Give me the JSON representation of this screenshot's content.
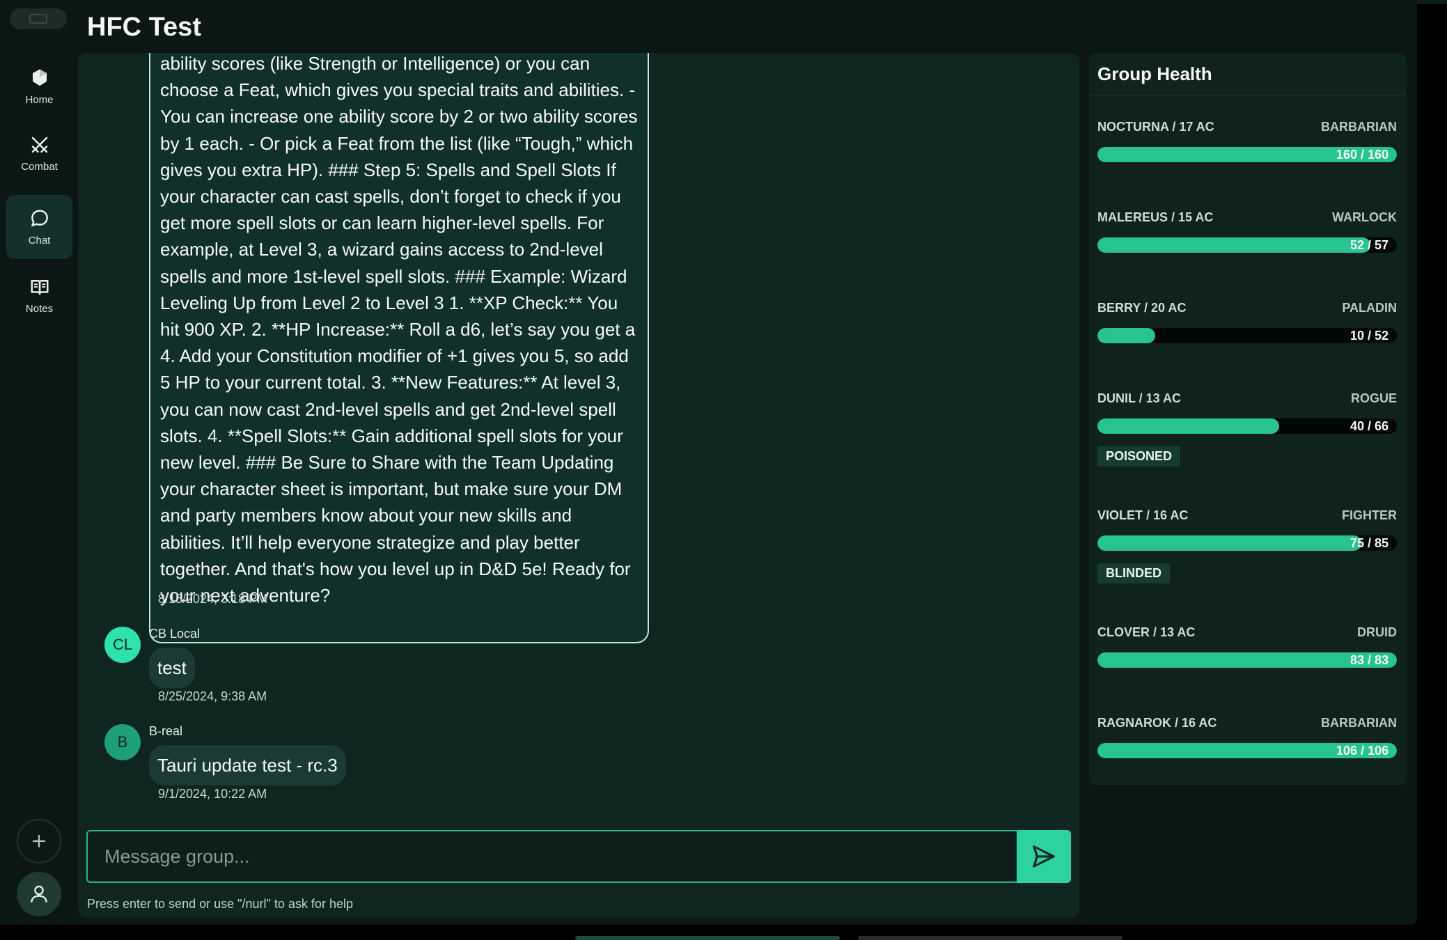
{
  "app": {
    "title": "HFC Test"
  },
  "sidebar": {
    "items": [
      {
        "label": "Home",
        "icon": "home-icon"
      },
      {
        "label": "Combat",
        "icon": "combat-icon"
      },
      {
        "label": "Chat",
        "icon": "chat-icon",
        "active": true
      },
      {
        "label": "Notes",
        "icon": "notes-icon"
      }
    ],
    "add_icon": "plus-icon",
    "user_icon": "user-icon"
  },
  "chat": {
    "long_message": {
      "text": "ability scores (like Strength or Intelligence) or you can choose a Feat, which gives you special traits and abilities. - You can increase one ability score by 2 or two ability scores by 1 each. - Or pick a Feat from the list (like “Tough,” which gives you extra HP). ### Step 5: Spells and Spell Slots If your character can cast spells, don’t forget to check if you get more spell slots or can learn higher-level spells. For example, at Level 3, a wizard gains access to 2nd-level spells and more 1st-level spell slots. ### Example: Wizard Leveling Up from Level 2 to Level 3 1. **XP Check:** You hit 900 XP. 2. **HP Increase:** Roll a d6, let’s say you get a 4. Add your Constitution modifier of +1 gives you 5, so add 5 HP to your current total. 3. **New Features:** At level 3, you can now cast 2nd-level spells and get 2nd-level spell slots. 4. **Spell Slots:** Gain additional spell slots for your new level. ### Be Sure to Share with the Team Updating your character sheet is important, but make sure your DM and party members know about your new skills and abilities. It’ll help everyone strategize and play better together. And that's how you level up in D&D 5e! Ready for your next adventure?",
      "timestamp": "8/15/2024, 3:18 PM"
    },
    "messages": [
      {
        "initials": "CL",
        "author": "CB Local",
        "text": "test",
        "timestamp": "8/25/2024, 9:38 AM"
      },
      {
        "initials": "B",
        "author": "B-real",
        "text": "Tauri update test - rc.3",
        "timestamp": "9/1/2024, 10:22 AM"
      }
    ],
    "composer": {
      "placeholder": "Message group...",
      "send_icon": "send-icon",
      "hint": "Press enter to send or use \"/nurl\" to ask for help"
    }
  },
  "group_health": {
    "title": "Group Health",
    "members": [
      {
        "name": "NOCTURNA / 17 AC",
        "class": "BARBARIAN",
        "hp": "160 / 160",
        "fraction": 1.0,
        "conditions": []
      },
      {
        "name": "MALEREUS / 15 AC",
        "class": "WARLOCK",
        "hp": "52 / 57",
        "fraction": 0.912,
        "conditions": []
      },
      {
        "name": "BERRY / 20 AC",
        "class": "PALADIN",
        "hp": "10 / 52",
        "fraction": 0.192,
        "conditions": []
      },
      {
        "name": "DUNIL / 13 AC",
        "class": "ROGUE",
        "hp": "40 / 66",
        "fraction": 0.606,
        "conditions": [
          "POISONED"
        ]
      },
      {
        "name": "VIOLET / 16 AC",
        "class": "FIGHTER",
        "hp": "75 / 85",
        "fraction": 0.882,
        "conditions": [
          "BLINDED"
        ]
      },
      {
        "name": "CLOVER / 13 AC",
        "class": "DRUID",
        "hp": "83 / 83",
        "fraction": 1.0,
        "conditions": []
      },
      {
        "name": "RAGNAROK / 16 AC",
        "class": "BARBARIAN",
        "hp": "106 / 106",
        "fraction": 1.0,
        "conditions": []
      }
    ]
  },
  "colors": {
    "accent": "#2ed1a0",
    "hp_fill": "#27c390",
    "background": "#0b1714"
  }
}
